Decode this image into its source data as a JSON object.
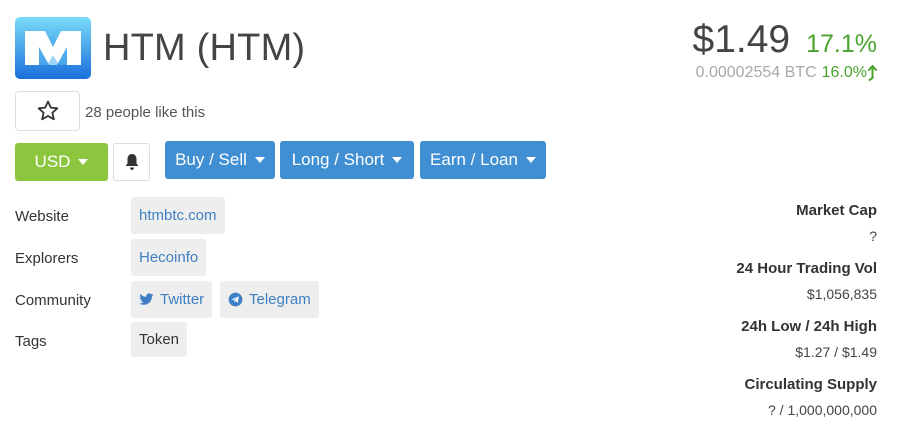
{
  "coin": {
    "title": "HTM (HTM)",
    "brand_colors": {
      "logo_light": "#6fd4f7",
      "logo_dark": "#1b7de0"
    }
  },
  "price": {
    "usd": "$1.49",
    "usd_change": "17.1%",
    "btc": "0.00002554 BTC",
    "btc_change": "16.0%",
    "change_color": "#4aa52e"
  },
  "social": {
    "likes_text": "28 people like this",
    "star_icon": "star-icon"
  },
  "toolbar": {
    "currency_label": "USD",
    "bell_icon": "bell-icon",
    "buy_sell_label": "Buy / Sell",
    "long_short_label": "Long / Short",
    "earn_loan_label": "Earn / Loan",
    "accent_blue": "#3f8fd2",
    "accent_green": "#8cc63f"
  },
  "info": {
    "website": {
      "label": "Website",
      "links": [
        "htmbtc.com"
      ]
    },
    "explorers": {
      "label": "Explorers",
      "links": [
        "Hecoinfo"
      ]
    },
    "community": {
      "label": "Community",
      "links": [
        "Twitter",
        "Telegram"
      ]
    },
    "tags": {
      "label": "Tags",
      "items": [
        "Token"
      ]
    }
  },
  "stats": {
    "market_cap": {
      "label": "Market Cap",
      "value": "?"
    },
    "volume_24h": {
      "label": "24 Hour Trading Vol",
      "value": "$1,056,835"
    },
    "low_high_24h": {
      "label": "24h Low / 24h High",
      "value": "$1.27 / $1.49"
    },
    "circulating_supply": {
      "label": "Circulating Supply",
      "value": "? / 1,000,000,000"
    }
  }
}
